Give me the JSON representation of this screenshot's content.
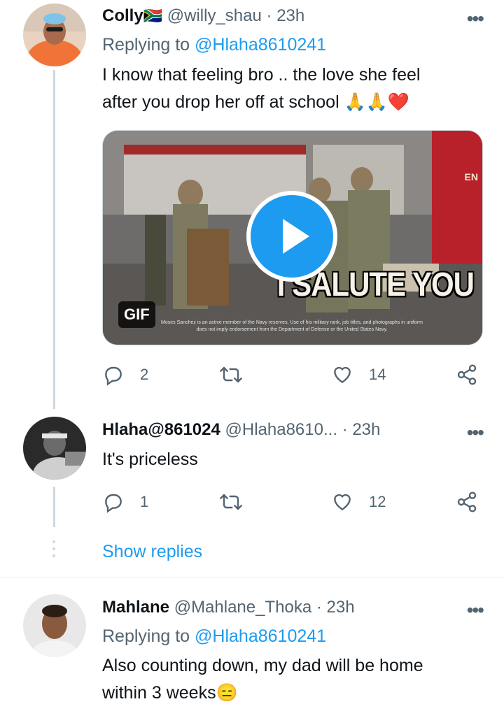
{
  "tweets": [
    {
      "name": "Colly",
      "flag": "🇿🇦",
      "handle": "@willy_shau",
      "dot": "·",
      "time": "23h",
      "replying_label": "Replying to",
      "replying_to": "@Hlaha8610241",
      "text_line1": "I know that feeling bro .. the love she feel",
      "text_line2": "after you drop her off at school 🙏🙏❤️",
      "media": {
        "gif_label": "GIF",
        "overlay_text": "I SALUTE YOU",
        "disclaimer": "Moses Sanchez is an active member of the Navy reserves. Use of his military rank, job titles, and photographs in uniform does not imply endorsement from the Department of Defense or the United States Navy.",
        "truck_text": "EN"
      },
      "replies": "2",
      "retweets": "",
      "likes": "14"
    },
    {
      "name": "Hlaha@861024",
      "handle": "@Hlaha8610...",
      "dot": "·",
      "time": "23h",
      "text_line1": "It's priceless",
      "replies": "1",
      "retweets": "",
      "likes": "12"
    },
    {
      "name": "Mahlane",
      "handle": "@Mahlane_Thoka",
      "dot": "·",
      "time": "23h",
      "replying_label": "Replying to",
      "replying_to": "@Hlaha8610241",
      "text_line1": "Also counting down, my dad will be home",
      "text_line2": "within 3 weeks😑"
    }
  ],
  "show_replies": "Show replies",
  "more_icon": "•••",
  "colors": {
    "accent": "#1d9bf0",
    "secondary_text": "#536471",
    "thread_line": "#cfd9de"
  }
}
